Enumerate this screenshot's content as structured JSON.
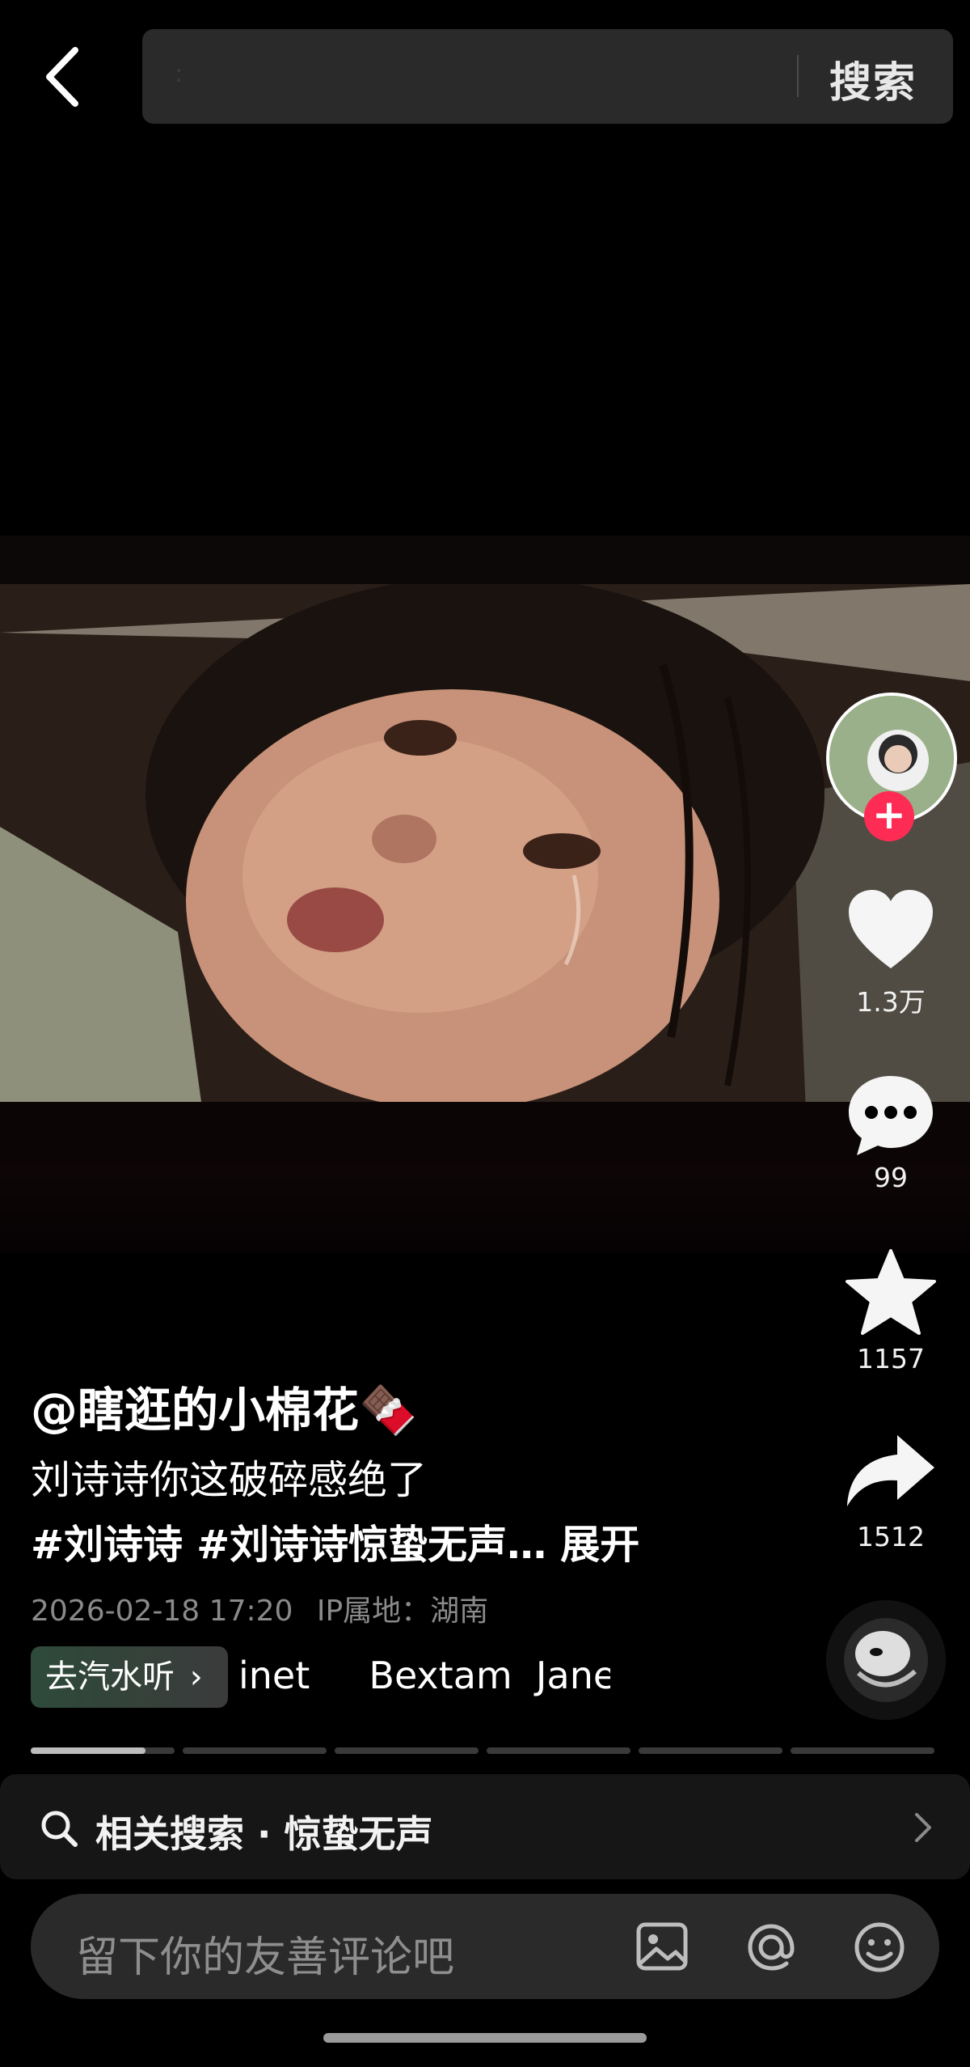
{
  "header": {
    "search_placeholder": ":",
    "search_button": "搜索"
  },
  "right_rail": {
    "like_count": "1.3万",
    "comment_count": "99",
    "favorite_count": "1157",
    "share_count": "1512"
  },
  "post": {
    "author": "@瞎逛的小棉花🍫",
    "description": "刘诗诗你这破碎感绝了",
    "hashtags": "#刘诗诗 #刘诗诗惊蛰无声… 展开",
    "timestamp": "2026-02-18  17:20",
    "ip_location": "IP属地：湖南"
  },
  "music": {
    "pill_label": "去汽水听",
    "scrolling_text": "inet     Bextam  Jane"
  },
  "progress": {
    "segments": 6,
    "current_fill": 0.8
  },
  "related_search": {
    "label": "相关搜索 · 惊蛰无声"
  },
  "comment_box": {
    "placeholder": "留下你的友善评论吧"
  },
  "colors": {
    "background": "#000000",
    "follow_button": "#fe2c55",
    "search_bar": "#2a2a2a",
    "secondary_text": "#8a8a8a"
  }
}
